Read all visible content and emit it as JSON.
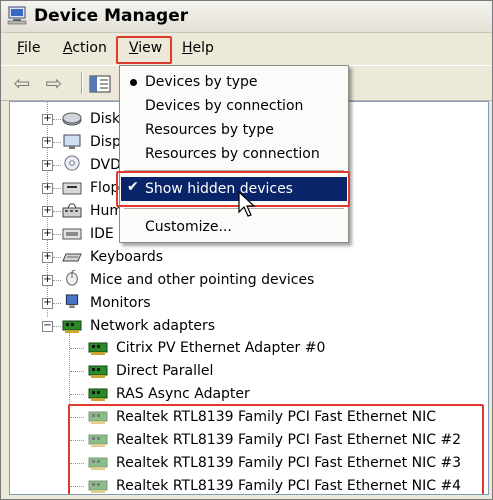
{
  "window": {
    "title": "Device Manager"
  },
  "menubar": {
    "items": [
      {
        "key": "F",
        "rest": "ile"
      },
      {
        "key": "A",
        "rest": "ction"
      },
      {
        "key": "V",
        "rest": "iew"
      },
      {
        "key": "H",
        "rest": "elp"
      }
    ]
  },
  "view_menu": {
    "items": [
      {
        "label": "Devices by type"
      },
      {
        "label": "Devices by connection"
      },
      {
        "label": "Resources by type"
      },
      {
        "label": "Resources by connection"
      },
      {
        "label": "Show hidden devices"
      },
      {
        "label": "Customize..."
      }
    ]
  },
  "tree": {
    "top_items": [
      {
        "label": "Disk"
      },
      {
        "label": "Disp"
      },
      {
        "label": "DVD"
      },
      {
        "label": "Flop"
      },
      {
        "label": "Hum"
      },
      {
        "label": "IDE"
      },
      {
        "label": "Keyboards"
      },
      {
        "label": "Mice and other pointing devices"
      },
      {
        "label": "Monitors"
      },
      {
        "label": "Network adapters"
      }
    ],
    "network_children": [
      {
        "label": "Citrix PV Ethernet Adapter #0"
      },
      {
        "label": "Direct Parallel"
      },
      {
        "label": "RAS Async Adapter"
      },
      {
        "label": "Realtek RTL8139 Family PCI Fast Ethernet NIC"
      },
      {
        "label": "Realtek RTL8139 Family PCI Fast Ethernet NIC #2"
      },
      {
        "label": "Realtek RTL8139 Family PCI Fast Ethernet NIC #3"
      },
      {
        "label": "Realtek RTL8139 Family PCI Fast Ethernet NIC #4"
      }
    ]
  },
  "colors": {
    "highlight_box": "#e0392e",
    "selection": "#0a246a",
    "nic_icon": "#2a8a2a"
  }
}
